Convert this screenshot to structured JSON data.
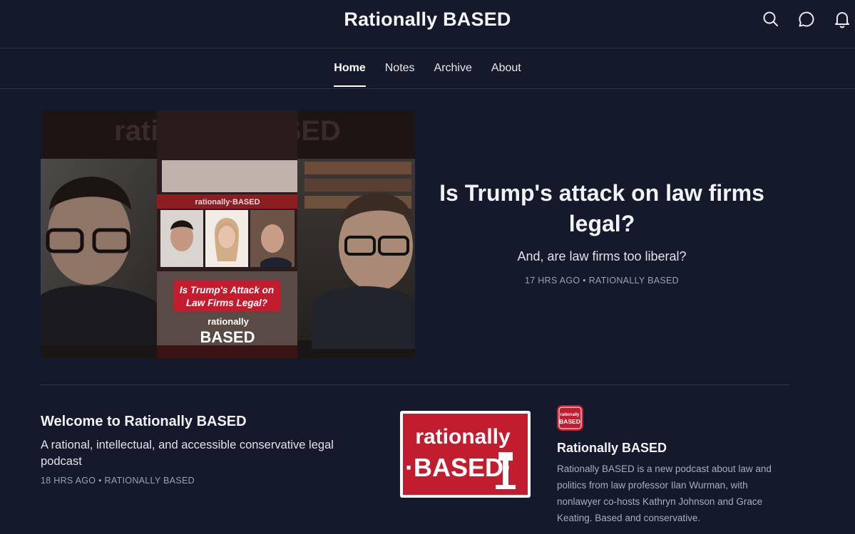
{
  "site": {
    "title": "Rationally BASED"
  },
  "header": {
    "icons": [
      "search-icon",
      "chat-icon",
      "bell-icon"
    ]
  },
  "nav": {
    "tabs": [
      {
        "label": "Home",
        "active": true
      },
      {
        "label": "Notes",
        "active": false
      },
      {
        "label": "Archive",
        "active": false
      },
      {
        "label": "About",
        "active": false
      }
    ]
  },
  "hero": {
    "title": "Is Trump's attack on law firms legal?",
    "subtitle": "And, are law firms too liberal?",
    "meta": "17 HRS AGO • RATIONALLY BASED",
    "image": {
      "banner_text": "rationallyBASED",
      "caption_line1": "Is Trump's Attack on",
      "caption_line2": "Law Firms Legal?",
      "logo_word1": "rationally",
      "logo_word2": "BASED",
      "mini_banner": "rationally·BASED"
    }
  },
  "post": {
    "title": "Welcome to Rationally BASED",
    "subtitle": "A rational, intellectual, and accessible conservative legal podcast",
    "meta": "18 HRS AGO • RATIONALLY BASED",
    "thumb_word1": "rationally",
    "thumb_word2": "·BASED·"
  },
  "publication": {
    "logo_word1": "rationally",
    "logo_word2": "BASED",
    "name": "Rationally BASED",
    "description": "Rationally BASED is a new podcast about law and politics from law professor Ilan Wurman, with nonlawyer co-hosts Kathryn Johnson and Grace Keating. Based and conservative."
  },
  "colors": {
    "background": "#141a2b",
    "brand_red": "#c21d2f",
    "text_primary": "#f1f2f6",
    "text_muted": "#9aa1b0"
  }
}
